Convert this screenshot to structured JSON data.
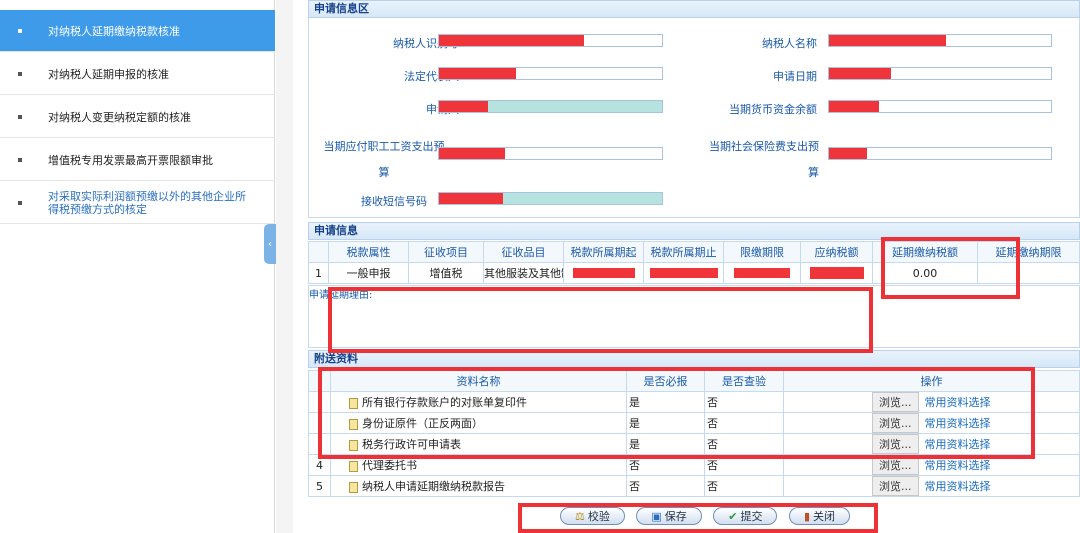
{
  "sidebar": {
    "items": [
      {
        "label": "对纳税人延期缴纳税款核准",
        "active": true
      },
      {
        "label": "对纳税人延期申报的核准"
      },
      {
        "label": "对纳税人变更纳税定额的核准"
      },
      {
        "label": "增值税专用发票最高开票限额审批"
      },
      {
        "label": "对采取实际利润额预缴以外的其他企业所得税预缴方式的核定"
      }
    ],
    "toggle_icon": "chevron-left-icon"
  },
  "applicant_section": {
    "title": "申请信息区",
    "fields": {
      "taxpayer_id": "纳税人识别号",
      "taxpayer_name": "纳税人名称",
      "legal_rep": "法定代表人",
      "apply_date": "申请日期",
      "applicant": "申请人",
      "cash_balance": "当期货币资金余额",
      "wage_budget": "当期应付职工工资支出预算",
      "social_budget": "当期社会保险费支出预算",
      "sms_phone": "接收短信号码"
    }
  },
  "apply_info": {
    "title": "申请信息",
    "headers": [
      "",
      "税款属性",
      "征收项目",
      "征收品目",
      "税款所属期起",
      "税款所属期止",
      "限缴期限",
      "应纳税额",
      "延期缴纳税额",
      "延期缴纳期限"
    ],
    "rows": [
      {
        "no": "1",
        "attr": "一般申报",
        "item": "增值税",
        "subitem": "其他服装及其他制",
        "deferred_amount": "0.00"
      }
    ],
    "reason_label": "申请延期理由:"
  },
  "attachments": {
    "title": "附送资料",
    "headers": [
      "",
      "资料名称",
      "是否必报",
      "是否查验",
      "操作"
    ],
    "browse_label": "浏览...",
    "choose_label": "常用资料选择",
    "rows": [
      {
        "no": "",
        "name": "所有银行存款账户的对账单复印件",
        "required": "是",
        "checked": "否"
      },
      {
        "no": "",
        "name": "身份证原件（正反两面）",
        "required": "是",
        "checked": "否"
      },
      {
        "no": "",
        "name": "税务行政许可申请表",
        "required": "是",
        "checked": "否"
      },
      {
        "no": "4",
        "name": "代理委托书",
        "required": "否",
        "checked": "否"
      },
      {
        "no": "5",
        "name": "纳税人申请延期缴纳税款报告",
        "required": "否",
        "checked": "否"
      }
    ]
  },
  "buttons": {
    "verify": "校验",
    "save": "保存",
    "submit": "提交",
    "close": "关闭"
  }
}
